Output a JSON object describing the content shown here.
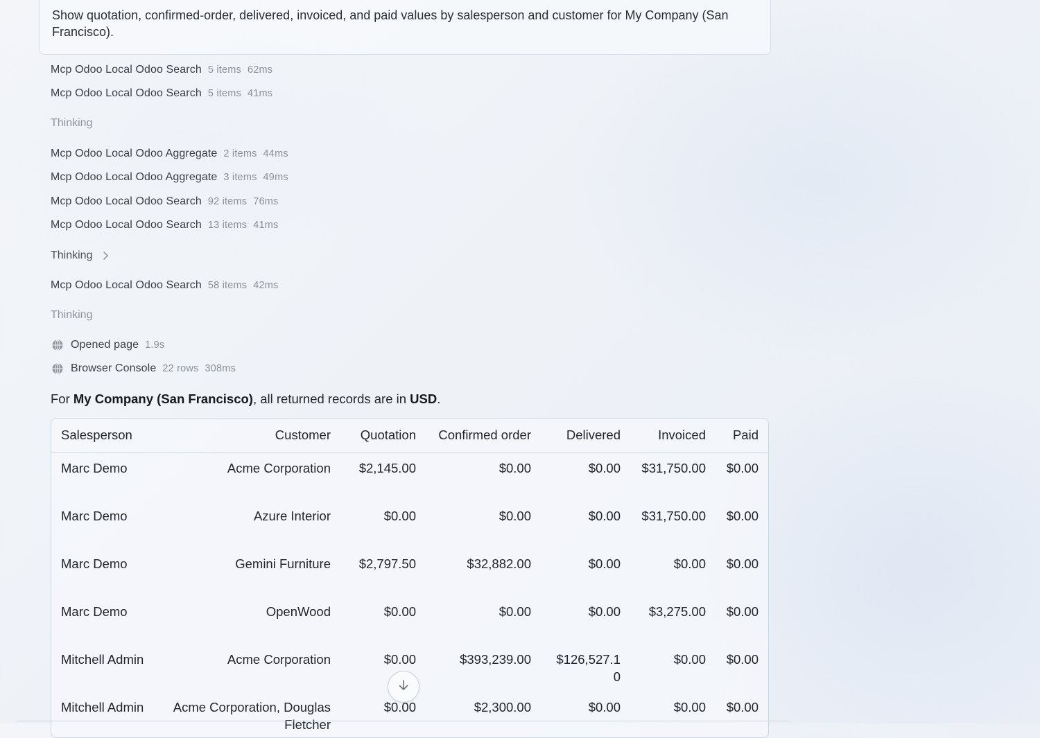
{
  "prompt": {
    "text": "Show quotation, confirmed-order, delivered, invoiced, and paid values by salesperson and customer for My Company (San Francisco)."
  },
  "steps": [
    {
      "kind": "tool",
      "tool": "Mcp Odoo Local Odoo Search",
      "count": "5 items",
      "time": "62ms"
    },
    {
      "kind": "tool",
      "tool": "Mcp Odoo Local Odoo Search",
      "count": "5 items",
      "time": "41ms"
    },
    {
      "kind": "thinking",
      "label": "Thinking"
    },
    {
      "kind": "tool",
      "tool": "Mcp Odoo Local Odoo Aggregate",
      "count": "2 items",
      "time": "44ms"
    },
    {
      "kind": "tool",
      "tool": "Mcp Odoo Local Odoo Aggregate",
      "count": "3 items",
      "time": "49ms"
    },
    {
      "kind": "tool",
      "tool": "Mcp Odoo Local Odoo Search",
      "count": "92 items",
      "time": "76ms"
    },
    {
      "kind": "tool",
      "tool": "Mcp Odoo Local Odoo Search",
      "count": "13 items",
      "time": "41ms"
    },
    {
      "kind": "thinking",
      "label": "Thinking",
      "expandable": true
    },
    {
      "kind": "tool",
      "tool": "Mcp Odoo Local Odoo Search",
      "count": "58 items",
      "time": "42ms"
    },
    {
      "kind": "thinking",
      "label": "Thinking"
    },
    {
      "kind": "browser",
      "icon": "globe-icon",
      "tool": "Opened page",
      "time": "1.9s"
    },
    {
      "kind": "browser",
      "icon": "globe-icon",
      "tool": "Browser Console",
      "count": "22 rows",
      "time": "308ms"
    }
  ],
  "summary": {
    "prefix": "For ",
    "company": "My Company (San Francisco)",
    "middle": ", all returned records are in ",
    "currency": "USD",
    "suffix": "."
  },
  "table": {
    "headers": [
      "Salesperson",
      "Customer",
      "Quotation",
      "Confirmed order",
      "Delivered",
      "Invoiced",
      "Paid"
    ],
    "rows": [
      [
        "Marc Demo",
        "Acme Corporation",
        "$2,145.00",
        "$0.00",
        "$0.00",
        "$31,750.00",
        "$0.00"
      ],
      [
        "Marc Demo",
        "Azure Interior",
        "$0.00",
        "$0.00",
        "$0.00",
        "$31,750.00",
        "$0.00"
      ],
      [
        "Marc Demo",
        "Gemini Furniture",
        "$2,797.50",
        "$32,882.00",
        "$0.00",
        "$0.00",
        "$0.00"
      ],
      [
        "Marc Demo",
        "OpenWood",
        "$0.00",
        "$0.00",
        "$0.00",
        "$3,275.00",
        "$0.00"
      ],
      [
        "Mitchell Admin",
        "Acme Corporation",
        "$0.00",
        "$393,239.00",
        "$126,527.10",
        "$0.00",
        "$0.00"
      ],
      [
        "Mitchell Admin",
        "Acme Corporation, Douglas Fletcher",
        "$0.00",
        "$2,300.00",
        "$0.00",
        "$0.00",
        "$0.00"
      ]
    ]
  },
  "scroll_button": {
    "icon": "arrow-down-icon"
  }
}
